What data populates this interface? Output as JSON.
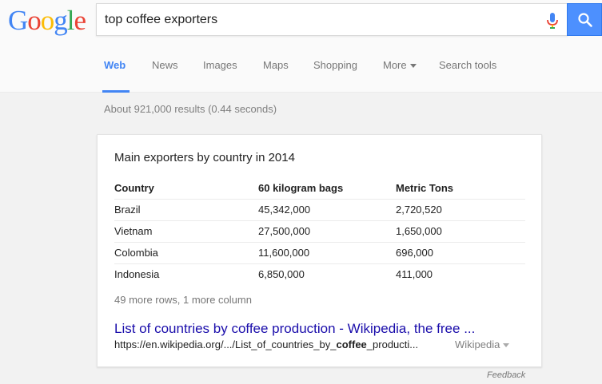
{
  "logo": {
    "letters": [
      {
        "ch": "G",
        "color": "#4285f4"
      },
      {
        "ch": "o",
        "color": "#ea4335"
      },
      {
        "ch": "o",
        "color": "#fbbc05"
      },
      {
        "ch": "g",
        "color": "#4285f4"
      },
      {
        "ch": "l",
        "color": "#34a853"
      },
      {
        "ch": "e",
        "color": "#ea4335"
      }
    ]
  },
  "search": {
    "query": "top coffee exporters",
    "mic_icon": "microphone-icon",
    "button_icon": "search-icon",
    "button_color": "#4d90fe"
  },
  "tabs": {
    "web": "Web",
    "news": "News",
    "images": "Images",
    "maps": "Maps",
    "shopping": "Shopping",
    "more": "More",
    "search_tools": "Search tools",
    "active_color": "#4285f4"
  },
  "stats": "About 921,000 results (0.44 seconds)",
  "card": {
    "title": "Main exporters by country in 2014",
    "headers": [
      "Country",
      "60 kilogram bags",
      "Metric Tons"
    ],
    "rows": [
      [
        "Brazil",
        "45,342,000",
        "2,720,520"
      ],
      [
        "Vietnam",
        "27,500,000",
        "1,650,000"
      ],
      [
        "Colombia",
        "11,600,000",
        "696,000"
      ],
      [
        "Indonesia",
        "6,850,000",
        "411,000"
      ]
    ],
    "more_rows": "49 more rows, 1 more column",
    "result_title": "List of countries by coffee production - Wikipedia, the free ...",
    "url_before": "https://en.wikipedia.org/.../List_of_countries_by_",
    "url_bold": "coffee",
    "url_after": "_producti...",
    "source": "Wikipedia"
  },
  "feedback": "Feedback",
  "colors": {
    "link": "#1a0dab",
    "muted": "#808080"
  }
}
